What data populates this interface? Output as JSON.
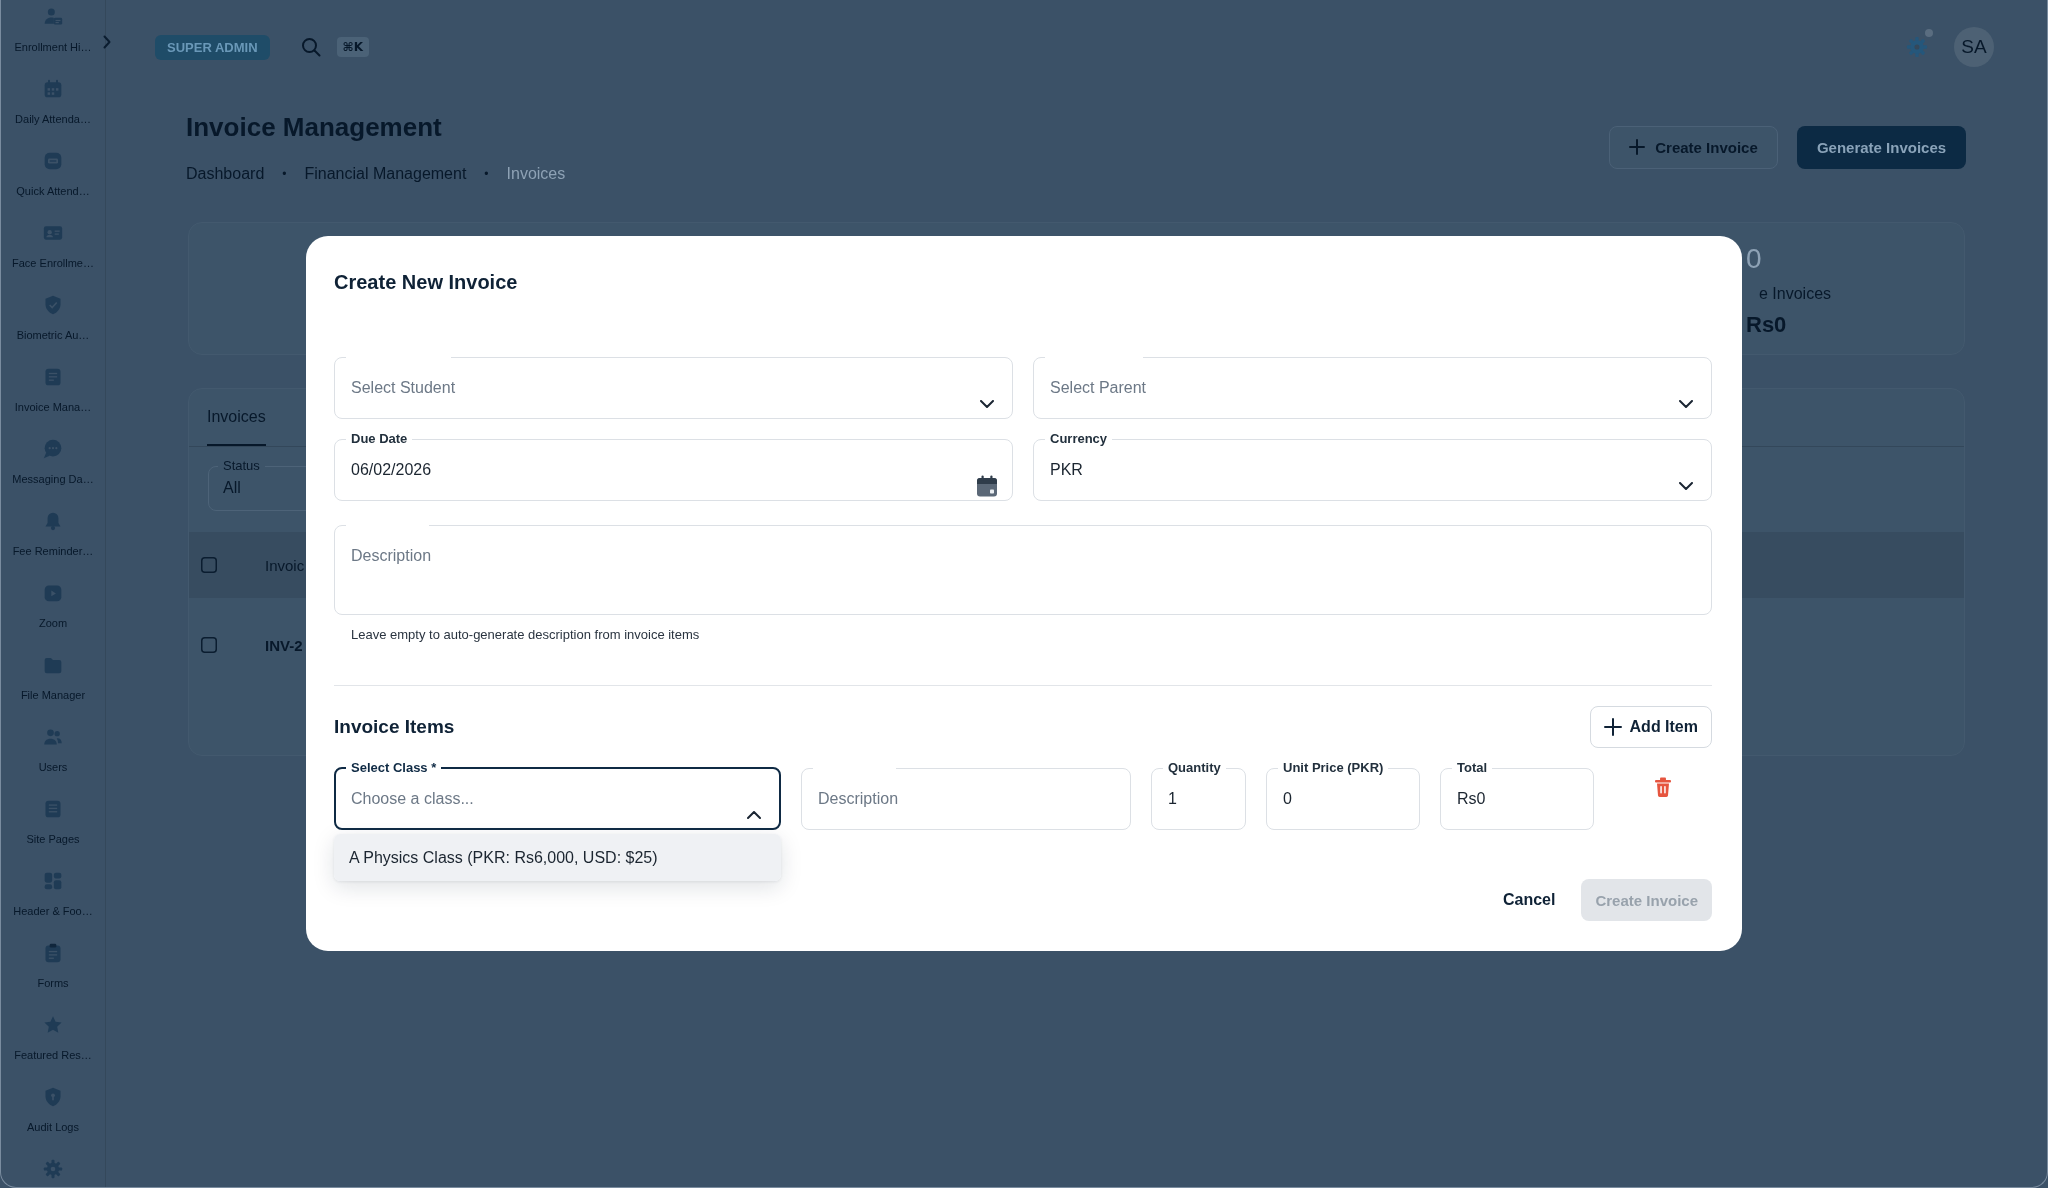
{
  "sidebar": {
    "items": [
      {
        "kind": "labeled",
        "label": "Enrollment Hi…"
      },
      {
        "kind": "labeled",
        "label": "Daily Attenda…"
      },
      {
        "kind": "labeled",
        "label": "Quick Attend…"
      },
      {
        "kind": "labeled",
        "label": "Face Enrollme…"
      },
      {
        "kind": "labeled",
        "label": "Biometric Au…"
      },
      {
        "kind": "labeled",
        "label": "Invoice Mana…"
      },
      {
        "kind": "labeled",
        "label": "Messaging Da…"
      },
      {
        "kind": "labeled",
        "label": "Fee Reminder…"
      },
      {
        "kind": "labeled",
        "label": "Zoom"
      },
      {
        "kind": "labeled",
        "label": "File Manager"
      },
      {
        "kind": "labeled",
        "label": "Users"
      },
      {
        "kind": "labeled",
        "label": "Site Pages"
      },
      {
        "kind": "labeled",
        "label": "Header & Foo…"
      },
      {
        "kind": "labeled",
        "label": "Forms"
      },
      {
        "kind": "labeled",
        "label": "Featured Res…"
      },
      {
        "kind": "labeled",
        "label": "Audit Logs"
      },
      {
        "kind": "icon_only"
      }
    ]
  },
  "topbar": {
    "role_badge": "SUPER ADMIN",
    "shortcut": "⌘K",
    "avatar": "SA"
  },
  "page": {
    "title": "Invoice Management",
    "breadcrumbs": [
      {
        "label": "Dashboard",
        "current": false
      },
      {
        "label": "Financial Management",
        "current": false
      },
      {
        "label": "Invoices",
        "current": true
      }
    ],
    "separators": [
      "•",
      "•"
    ],
    "actions": [
      {
        "kind": "outlined",
        "label": "Create Invoice"
      },
      {
        "kind": "filled",
        "label": "Generate Invoices"
      }
    ]
  },
  "stat_card": {
    "value": "0",
    "label": "e Invoices",
    "amount": "Rs0"
  },
  "invoices_panel": {
    "tabs": [
      {
        "label": "Invoices",
        "selected": true
      }
    ],
    "status_filter": {
      "label": "Status",
      "value": "All"
    },
    "table": {
      "header_checked": false,
      "columns": [
        "Invoic"
      ],
      "rows": [
        {
          "checked": false,
          "cells": [
            "INV-2"
          ]
        }
      ]
    }
  },
  "dialog": {
    "title": "Create New Invoice",
    "fields": [
      {
        "kind": "select",
        "placeholder": "Select Student",
        "focused": false,
        "expanded": false
      },
      {
        "kind": "select",
        "placeholder": "Select Parent",
        "focused": false,
        "expanded": false
      },
      {
        "kind": "date",
        "label": "Due Date",
        "value": "06/02/2026",
        "focused": false
      },
      {
        "kind": "select",
        "label": "Currency",
        "value": "PKR",
        "focused": false,
        "expanded": false
      },
      {
        "kind": "textarea",
        "placeholder": "Description",
        "focused": false
      }
    ],
    "helper_text": "Leave empty to auto-generate description from invoice items",
    "items": {
      "title": "Invoice Items",
      "add_button": "Add Item",
      "rows": [
        {
          "fields": [
            {
              "kind": "select",
              "label": "Select Class *",
              "placeholder": "Choose a class...",
              "focused": true,
              "expanded": true,
              "options": [
                {
                  "label": "A Physics Class (PKR: Rs6,000, USD: $25)",
                  "highlighted": true
                }
              ]
            },
            {
              "kind": "text",
              "placeholder": "Description",
              "focused": false
            },
            {
              "kind": "text",
              "label": "Quantity",
              "value": "1",
              "focused": false
            },
            {
              "kind": "text",
              "label": "Unit Price (PKR)",
              "value": "0",
              "focused": false
            },
            {
              "kind": "text",
              "label": "Total",
              "value": "Rs0",
              "focused": false
            }
          ]
        }
      ]
    },
    "buttons": [
      {
        "kind": "text",
        "label": "Cancel",
        "disabled": false
      },
      {
        "kind": "contained",
        "label": "Create Invoice",
        "disabled": true
      }
    ]
  }
}
